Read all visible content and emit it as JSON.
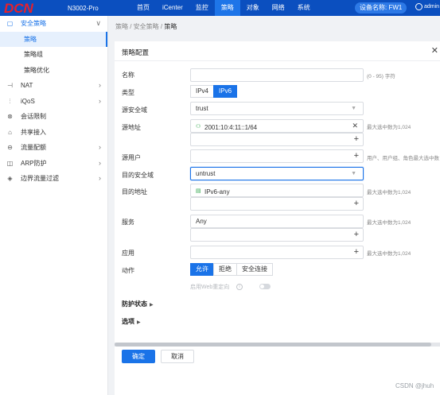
{
  "topbar": {
    "logo_text": "DCN",
    "model": "N3002-Pro",
    "nav": [
      {
        "label": "首页",
        "active": false
      },
      {
        "label": "iCenter",
        "active": false
      },
      {
        "label": "监控",
        "active": false
      },
      {
        "label": "策略",
        "active": true
      },
      {
        "label": "对象",
        "active": false
      },
      {
        "label": "网络",
        "active": false
      },
      {
        "label": "系统",
        "active": false
      }
    ],
    "device_name": "设备名称: FW1",
    "user": "admin"
  },
  "sidebar": {
    "items": [
      {
        "label": "安全策略",
        "icon": "shield-outline-icon",
        "chevron": "∨",
        "open": true
      },
      {
        "label": "NAT",
        "icon": "nat-icon",
        "chevron": "›"
      },
      {
        "label": "iQoS",
        "icon": "bars-icon",
        "chevron": "›"
      },
      {
        "label": "会话限制",
        "icon": "limit-icon",
        "chevron": ""
      },
      {
        "label": "共享接入",
        "icon": "share-icon",
        "chevron": ""
      },
      {
        "label": "流量配额",
        "icon": "quota-icon",
        "chevron": "›"
      },
      {
        "label": "ARP防护",
        "icon": "arp-icon",
        "chevron": "›"
      },
      {
        "label": "边界流量过滤",
        "icon": "filter-icon",
        "chevron": "›"
      }
    ],
    "subitems": [
      {
        "label": "策略",
        "active": true
      },
      {
        "label": "策略组",
        "active": false
      },
      {
        "label": "策略优化",
        "active": false
      }
    ]
  },
  "breadcrumb": {
    "path": "策略 / 安全策略 / ",
    "current": "策略"
  },
  "panel": {
    "title": "策略配置",
    "name": {
      "label": "名称",
      "value": "",
      "hint": "(0 - 95) 字符"
    },
    "type": {
      "label": "类型",
      "options": [
        "IPv4",
        "IPv6"
      ],
      "selected": "IPv6"
    },
    "src_zone": {
      "label": "源安全域",
      "value": "trust"
    },
    "src_addr": {
      "label": "源地址",
      "value": "2001:10:4:11::1/64",
      "hint": "最大选中数为1,024"
    },
    "src_user": {
      "label": "源用户",
      "hint": "用户、用户组、角色最大选中数"
    },
    "dst_zone": {
      "label": "目的安全域",
      "value": "untrust"
    },
    "dst_addr": {
      "label": "目的地址",
      "value": "IPv6-any",
      "hint": "最大选中数为1,024"
    },
    "service": {
      "label": "服务",
      "value": "Any",
      "hint": "最大选中数为1,024"
    },
    "app": {
      "label": "应用",
      "hint": "最大选中数为1,024"
    },
    "action": {
      "label": "动作",
      "options": [
        "允许",
        "拒绝",
        "安全连接"
      ],
      "selected": "允许"
    },
    "web_redirect": {
      "label": "启用Web重定向",
      "enabled": false
    },
    "protect_state": "防护状态",
    "options": "选项",
    "ok": "确定",
    "cancel": "取消"
  },
  "watermark": "CSDN @jhuh"
}
